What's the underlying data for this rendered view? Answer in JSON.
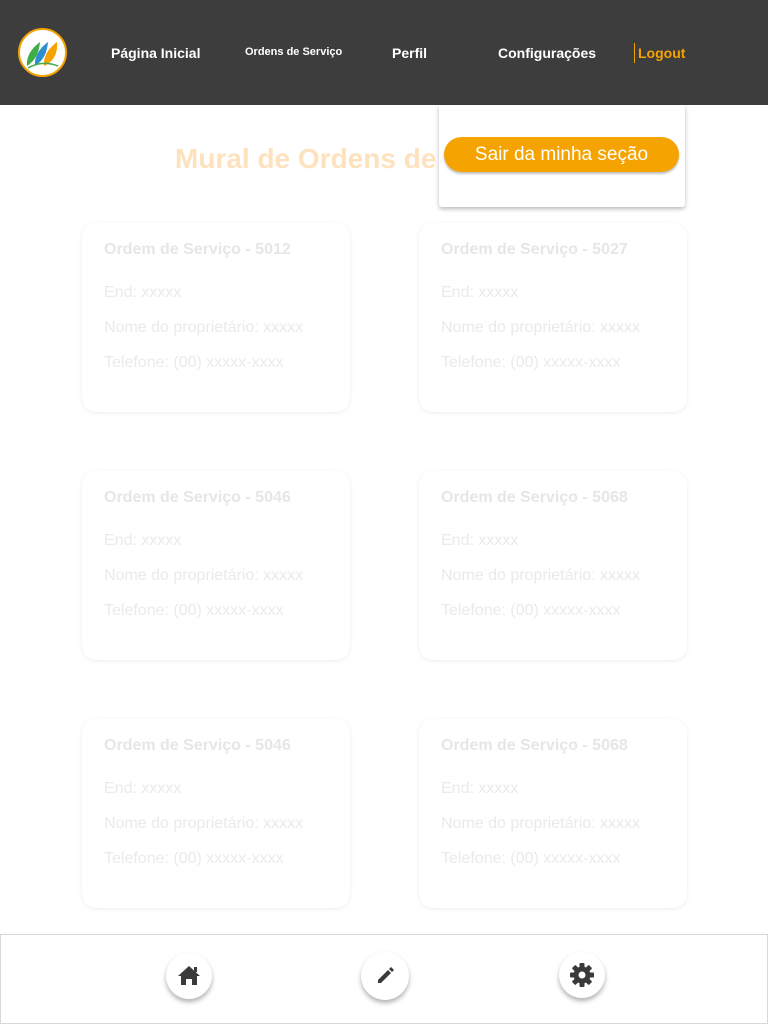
{
  "header": {
    "nav": [
      {
        "label": "Página Inicial"
      },
      {
        "label": "Ordens de Serviço"
      },
      {
        "label": "Perfil"
      },
      {
        "label": "Configurações"
      }
    ],
    "logout_label": "Logout"
  },
  "dropdown": {
    "logout_confirm_label": "Sair da minha seção"
  },
  "main": {
    "title": "Mural de Ordens de Serviço",
    "cards": [
      {
        "title": "Ordem de Serviço - 5012",
        "address": "End: xxxxx",
        "owner": "Nome do proprietário: xxxxx",
        "phone": "Telefone: (00) xxxxx-xxxx"
      },
      {
        "title": "Ordem de Serviço - 5027",
        "address": "End: xxxxx",
        "owner": "Nome do proprietário: xxxxx",
        "phone": "Telefone: (00) xxxxx-xxxx"
      },
      {
        "title": "Ordem de Serviço - 5046",
        "address": "End: xxxxx",
        "owner": "Nome do proprietário: xxxxx",
        "phone": "Telefone: (00) xxxxx-xxxx"
      },
      {
        "title": "Ordem de Serviço - 5068",
        "address": "End: xxxxx",
        "owner": "Nome do proprietário: xxxxx",
        "phone": "Telefone: (00) xxxxx-xxxx"
      },
      {
        "title": "Ordem de Serviço - 5046",
        "address": "End: xxxxx",
        "owner": "Nome do proprietário: xxxxx",
        "phone": "Telefone: (00) xxxxx-xxxx"
      },
      {
        "title": "Ordem de Serviço - 5068",
        "address": "End: xxxxx",
        "owner": "Nome do proprietário: xxxxx",
        "phone": "Telefone: (00) xxxxx-xxxx"
      }
    ]
  },
  "bottom_nav": {
    "icons": [
      "home-icon",
      "pencil-icon",
      "gear-icon"
    ]
  },
  "colors": {
    "header_bg": "#3d3d3d",
    "accent": "#f5a300",
    "title_faded": "#fde2bd"
  }
}
